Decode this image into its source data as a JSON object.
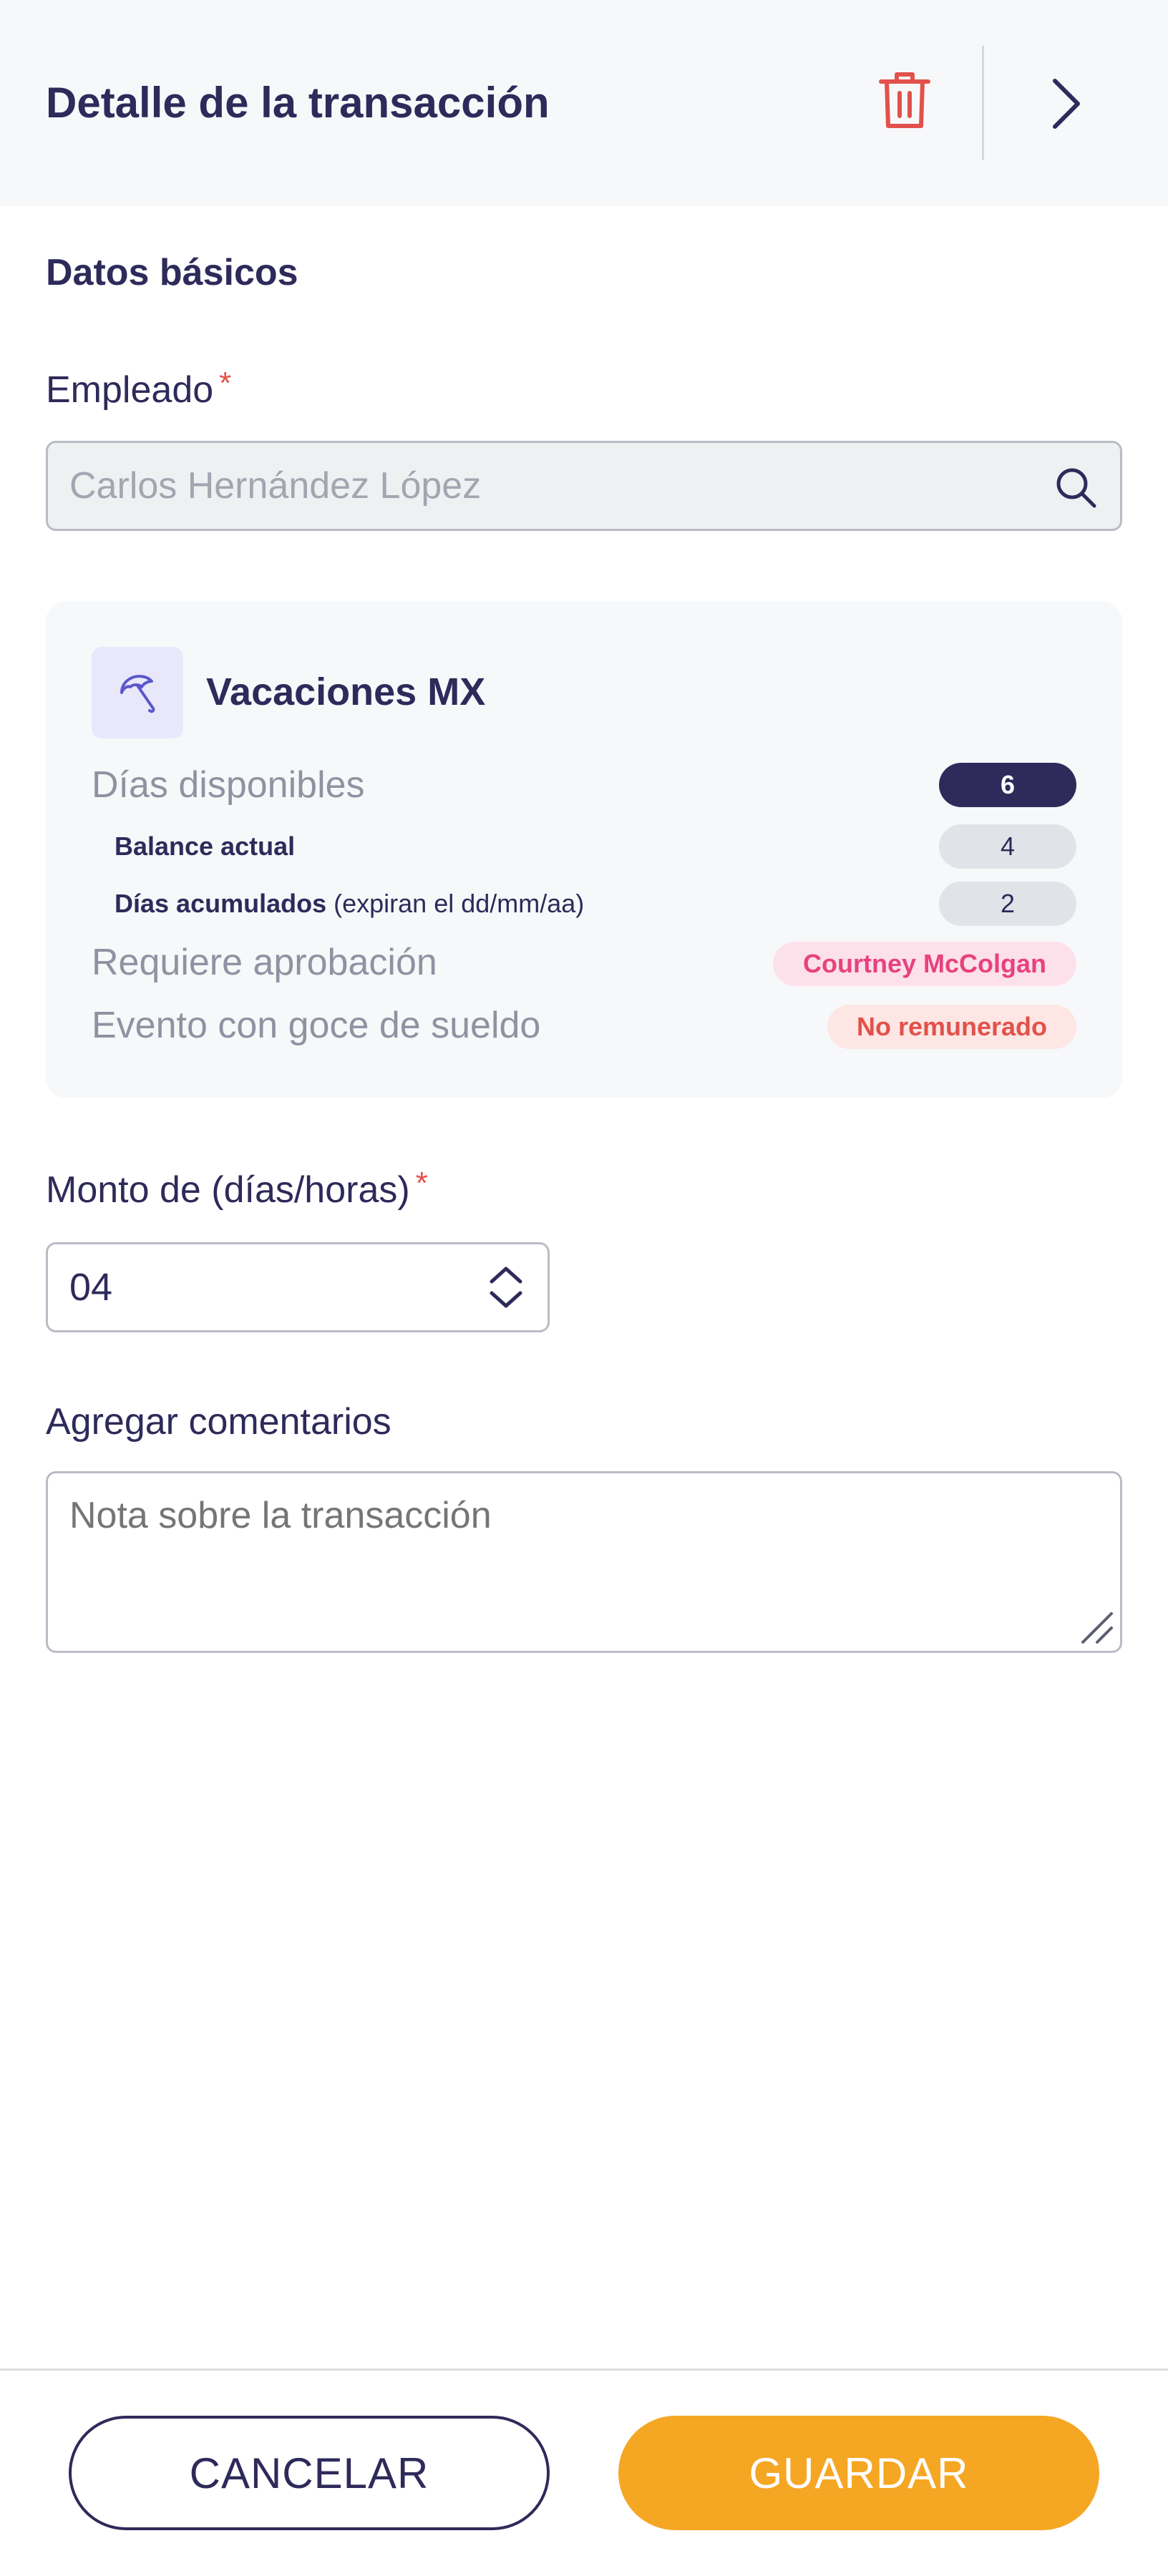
{
  "header": {
    "title": "Detalle de la transacción",
    "delete_icon": "trash-icon",
    "next_icon": "chevron-right-icon"
  },
  "section": {
    "title": "Datos básicos"
  },
  "employee": {
    "label": "Empleado",
    "required_mark": "*",
    "placeholder": "Carlos Hernández López",
    "icon": "search-icon"
  },
  "policy_card": {
    "icon": "umbrella-icon",
    "title": "Vacaciones MX",
    "available_days_label": "Días disponibles",
    "available_days_value": "6",
    "current_balance_label": "Balance actual",
    "current_balance_value": "4",
    "accrued_days_label": "Días acumulados",
    "accrued_days_note": "(expiran el dd/mm/aa)",
    "accrued_days_value": "2",
    "approval_label": "Requiere aprobación",
    "approval_value": "Courtney McColgan",
    "paid_event_label": "Evento con goce de sueldo",
    "paid_event_value": "No remunerado"
  },
  "amount": {
    "label": "Monto de (días/horas)",
    "required_mark": "*",
    "value": "04"
  },
  "comments": {
    "label": "Agregar comentarios",
    "placeholder": "Nota sobre la transacción"
  },
  "footer": {
    "cancel_label": "CANCELAR",
    "save_label": "GUARDAR"
  },
  "colors": {
    "primary_dark": "#2e2a5a",
    "accent_orange": "#f5a623",
    "danger_red": "#e2514b",
    "pink": "#e8417e"
  }
}
